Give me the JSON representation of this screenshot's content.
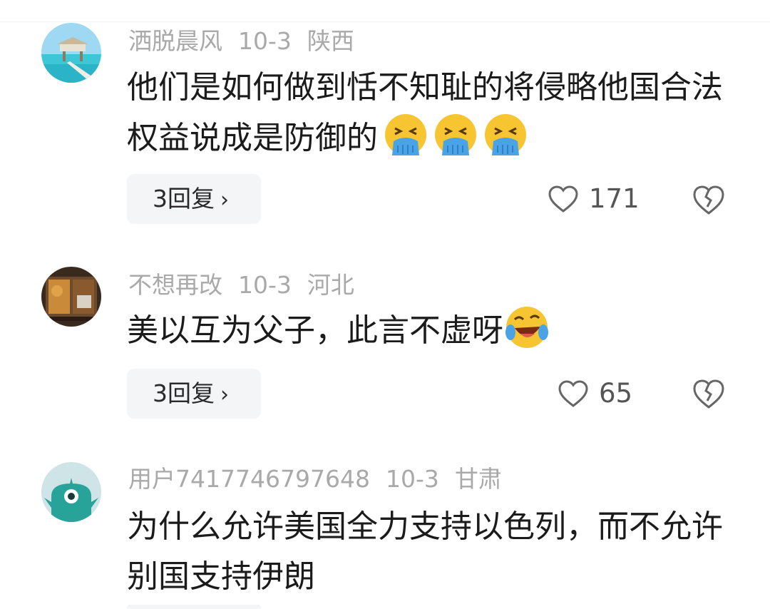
{
  "comments": [
    {
      "username": "洒脱晨风",
      "date": "10-3",
      "location": "陕西",
      "text": "他们是如何做到恬不知耻的将侵略他国合法权益说成是防御的",
      "emoji": "vomit-face-icon",
      "emoji_count": 3,
      "reply_label": "3回复",
      "likes": "171"
    },
    {
      "username": "不想再改",
      "date": "10-3",
      "location": "河北",
      "text": "美以互为父子，此言不虚呀",
      "emoji": "laughing-tears-face-icon",
      "emoji_count": 1,
      "reply_label": "3回复",
      "likes": "65"
    },
    {
      "username": "用户7417746797648",
      "date": "10-3",
      "location": "甘肃",
      "text": "为什么允许美国全力支持以色列，而不允许别国支持伊朗"
    }
  ],
  "colors": {
    "meta_text": "#a9a9a9",
    "body_text": "#1b1b1b",
    "reply_bg": "#f4f5f7",
    "emoji_yellow": "#f7c531",
    "emoji_blue": "#4aa3e6"
  }
}
